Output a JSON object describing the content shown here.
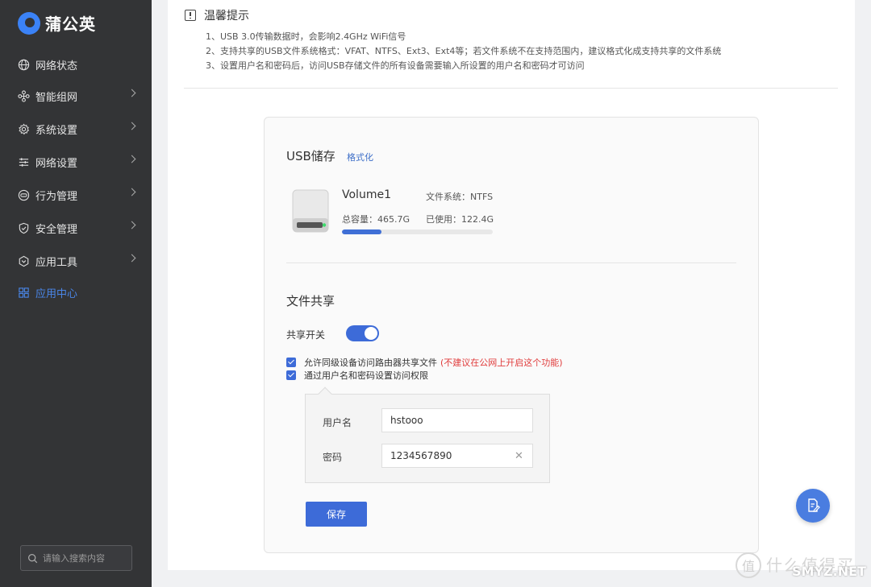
{
  "brand": {
    "name": "蒲公英"
  },
  "sidebar": {
    "items": [
      {
        "label": "网络状态",
        "icon": "globe-icon",
        "has_children": false,
        "active": false
      },
      {
        "label": "智能组网",
        "icon": "network-nodes-icon",
        "has_children": true,
        "active": false
      },
      {
        "label": "系统设置",
        "icon": "gear-icon",
        "has_children": true,
        "active": false
      },
      {
        "label": "网络设置",
        "icon": "sliders-icon",
        "has_children": true,
        "active": false
      },
      {
        "label": "行为管理",
        "icon": "behavior-icon",
        "has_children": true,
        "active": false
      },
      {
        "label": "安全管理",
        "icon": "shield-icon",
        "has_children": true,
        "active": false
      },
      {
        "label": "应用工具",
        "icon": "hexagon-tool-icon",
        "has_children": true,
        "active": false
      },
      {
        "label": "应用中心",
        "icon": "grid-apps-icon",
        "has_children": false,
        "active": true
      }
    ],
    "search_placeholder": "请输入搜索内容"
  },
  "tips": {
    "title": "温馨提示",
    "lines": [
      "1、USB 3.0传输数据时，会影响2.4GHz WiFi信号",
      "2、支持共享的USB文件系统格式：VFAT、NTFS、Ext3、Ext4等；若文件系统不在支持范围内，建议格式化成支持共享的文件系统",
      "3、设置用户名和密码后，访问USB存储文件的所有设备需要输入所设置的用户名和密码才可访问"
    ]
  },
  "usb": {
    "title": "USB储存",
    "format_link": "格式化",
    "volume_name": "Volume1",
    "filesystem": "文件系统：NTFS",
    "total": "总容量：465.7G",
    "used": "已使用：122.4G",
    "usage_fraction": 0.263
  },
  "share": {
    "title": "文件共享",
    "switch_label": "共享开关",
    "switch_on": true,
    "option1": "允许同级设备访问路由器共享文件",
    "option1_warning": "(不建议在公网上开启这个功能)",
    "option2": "通过用户名和密码设置访问权限",
    "username_label": "用户名",
    "username_value": "hstooo",
    "password_label": "密码",
    "password_value": "1234567890",
    "save_label": "保存"
  },
  "watermark": {
    "text": "什么值得买",
    "site": "SMYZ.NET",
    "glyph": "值"
  },
  "colors": {
    "accent": "#3d6bd8",
    "sidebar_bg": "#333436",
    "warning": "#e03b3b"
  }
}
